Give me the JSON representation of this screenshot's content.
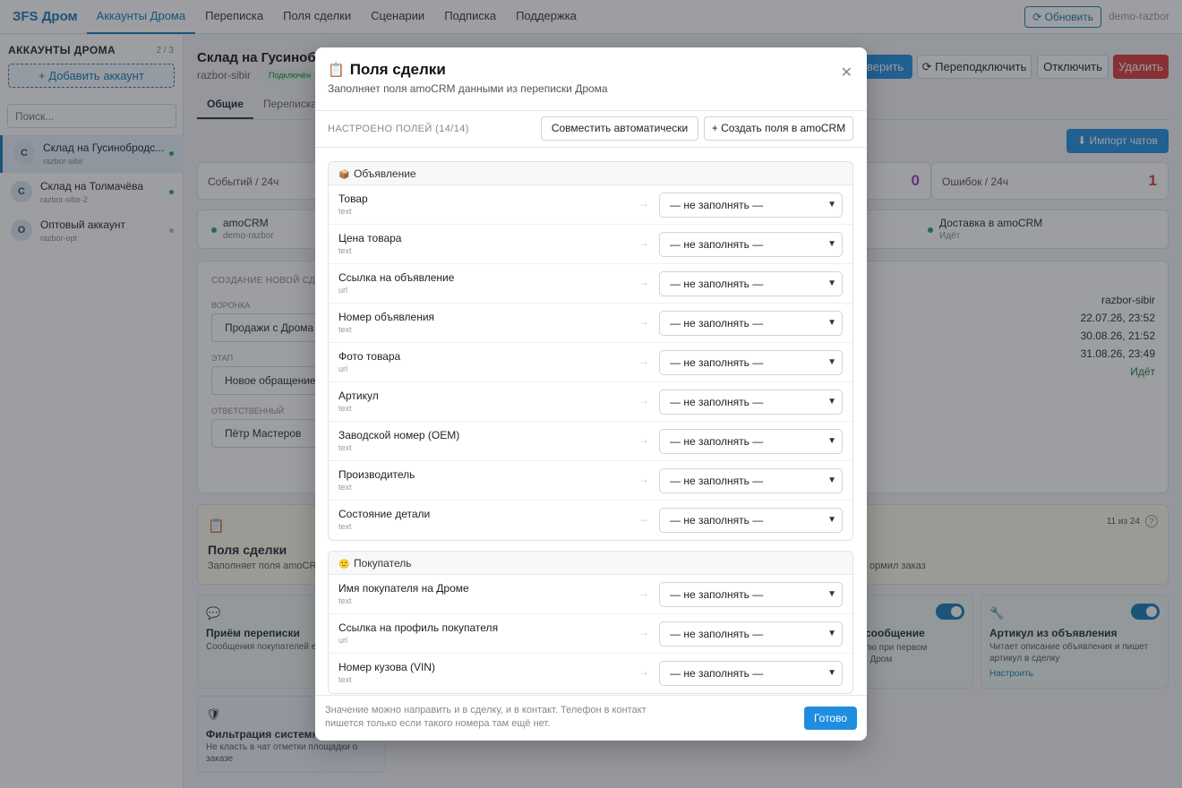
{
  "app": {
    "brand": "ЗFS Дром",
    "user": "demo-razbor",
    "refresh_label": "Обновить"
  },
  "nav": [
    "Аккаунты Дрома",
    "Переписка",
    "Поля сделки",
    "Сценарии",
    "Подписка",
    "Поддержка"
  ],
  "sidebar": {
    "title": "АККАУНТЫ ДРОМА",
    "count": "2 / 3",
    "add_label": "+ Добавить аккаунт",
    "search_placeholder": "Поиск...",
    "accounts": [
      {
        "initial": "С",
        "name": "Склад на Гусинобродс...",
        "login": "razbor-sibir",
        "active": true
      },
      {
        "initial": "С",
        "name": "Склад на Толмачёва",
        "login": "razbor-sibir-2",
        "active": true
      },
      {
        "initial": "О",
        "name": "Оптовый аккаунт",
        "login": "razbor-opt",
        "active": false
      }
    ]
  },
  "main": {
    "title": "Склад на Гусинобро",
    "login": "razbor-sibir",
    "status": "Подключён",
    "actions": {
      "check": "оверить",
      "reconnect": "Переподключить",
      "disconnect": "Отключить",
      "delete": "Удалить"
    },
    "tabs": [
      "Общие",
      "Переписка"
    ],
    "import_label": "Импорт чатов",
    "stats": {
      "events_label": "Событий / 24ч",
      "zero": "0",
      "errors_label": "Ошибок / 24ч",
      "errors": "1"
    },
    "integrations": {
      "amo_name": "amoCRM",
      "amo_sub": "demo-razbor",
      "delivery_name": "Доставка в amoCRM",
      "delivery_sub": "Идёт"
    },
    "deal": {
      "section": "СОЗДАНИЕ НОВОЙ СДЕ",
      "funnel_label": "ВОРОНКА",
      "funnel_value": "Продажи с Дрома",
      "stage_label": "ЭТАП",
      "stage_value": "Новое обращение",
      "owner_label": "ОТВЕТСТВЕННЫЙ",
      "owner_value": "Пётр Мастеров"
    },
    "info": [
      "razbor-sibir",
      "22.07.26, 23:52",
      "30.08.26, 21:52",
      "31.08.26, 23:49",
      "Идёт"
    ],
    "fields_card": {
      "title": "Поля сделки",
      "desc": "Заполняет поля amoCRM",
      "count": "11 из 24",
      "right_text": "ормил заказ"
    },
    "features": [
      {
        "title": "Приём переписки",
        "desc": "Сообщения покупателей е"
      },
      {
        "title": "е сообщение",
        "desc": "телю при первом\nт в Дром"
      },
      {
        "title": "Артикул из объявления",
        "desc": "Читает описание объявления и пишет артикул в сделку",
        "link": "Настроить"
      },
      {
        "title": "Фильтрация системн",
        "desc": "Не класть в чат отметки площадки о заказе"
      }
    ]
  },
  "modal": {
    "title": "Поля сделки",
    "subtitle": "Заполняет поля amoCRM данными из переписки Дрома",
    "configured": "НАСТРОЕНО ПОЛЕЙ (14/14)",
    "auto_match": "Совместить автоматически",
    "create_fields": "+ Создать поля в amoCRM",
    "select_value": "— не заполнять —",
    "groups": [
      {
        "title": "Объявление",
        "icon": "📦",
        "fields": [
          {
            "name": "Товар",
            "type": "text"
          },
          {
            "name": "Цена товара",
            "type": "text"
          },
          {
            "name": "Ссылка на объявление",
            "type": "url"
          },
          {
            "name": "Номер объявления",
            "type": "text"
          },
          {
            "name": "Фото товара",
            "type": "url"
          },
          {
            "name": "Артикул",
            "type": "text"
          },
          {
            "name": "Заводской номер (OEM)",
            "type": "text"
          },
          {
            "name": "Производитель",
            "type": "text"
          },
          {
            "name": "Состояние детали",
            "type": "text"
          }
        ]
      },
      {
        "title": "Покупатель",
        "icon": "🙂",
        "fields": [
          {
            "name": "Имя покупателя на Дроме",
            "type": "text"
          },
          {
            "name": "Ссылка на профиль покупателя",
            "type": "url"
          },
          {
            "name": "Номер кузова (VIN)",
            "type": "text"
          }
        ]
      }
    ],
    "footer_note": "Значение можно направить и в сделку, и в контакт. Телефон в контакт пишется только если такого номера там ещё нет.",
    "done": "Готово"
  }
}
